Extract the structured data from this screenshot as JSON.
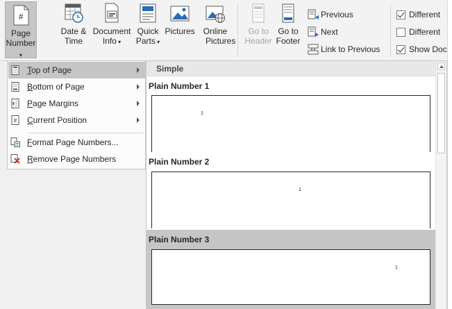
{
  "ribbon": {
    "page_number": {
      "line1": "Page",
      "line2": "Number",
      "icon_glyph": "#"
    },
    "date_time": {
      "line1": "Date &",
      "line2": "Time"
    },
    "document_info": {
      "line1": "Document",
      "line2": "Info"
    },
    "quick_parts": {
      "line1": "Quick",
      "line2": "Parts"
    },
    "pictures": {
      "line1": "Pictures",
      "line2": ""
    },
    "online_pictures": {
      "line1": "Online",
      "line2": "Pictures"
    },
    "go_to_header": {
      "line1": "Go to",
      "line2": "Header"
    },
    "go_to_footer": {
      "line1": "Go to",
      "line2": "Footer"
    },
    "previous": "Previous",
    "next": "Next",
    "link_to_previous": "Link to Previous",
    "options": [
      {
        "label": "Different",
        "checked": true
      },
      {
        "label": "Different",
        "checked": false
      },
      {
        "label": "Show Doc",
        "checked": true
      }
    ]
  },
  "menu": {
    "items": [
      {
        "accel": "T",
        "rest": "op of Page",
        "submenu": true,
        "selected": true
      },
      {
        "accel": "B",
        "rest": "ottom of Page",
        "submenu": true,
        "selected": false
      },
      {
        "accel": "P",
        "rest": "age Margins",
        "submenu": true,
        "selected": false
      },
      {
        "accel": "C",
        "rest": "urrent Position",
        "submenu": true,
        "selected": false
      },
      {
        "accel": "F",
        "rest": "ormat Page Numbers...",
        "submenu": false,
        "selected": false
      },
      {
        "accel": "R",
        "rest": "emove Page Numbers",
        "submenu": false,
        "selected": false
      }
    ]
  },
  "gallery": {
    "header": "Simple",
    "items": [
      {
        "label": "Plain Number 1",
        "number": "1",
        "selected": false
      },
      {
        "label": "Plain Number 2",
        "number": "1",
        "selected": false
      },
      {
        "label": "Plain Number 3",
        "number": "1",
        "selected": true
      }
    ]
  },
  "colors": {
    "selected_bg": "#c6c6c6",
    "accent_blue": "#2b6cb3",
    "remove_red": "#d13438"
  }
}
